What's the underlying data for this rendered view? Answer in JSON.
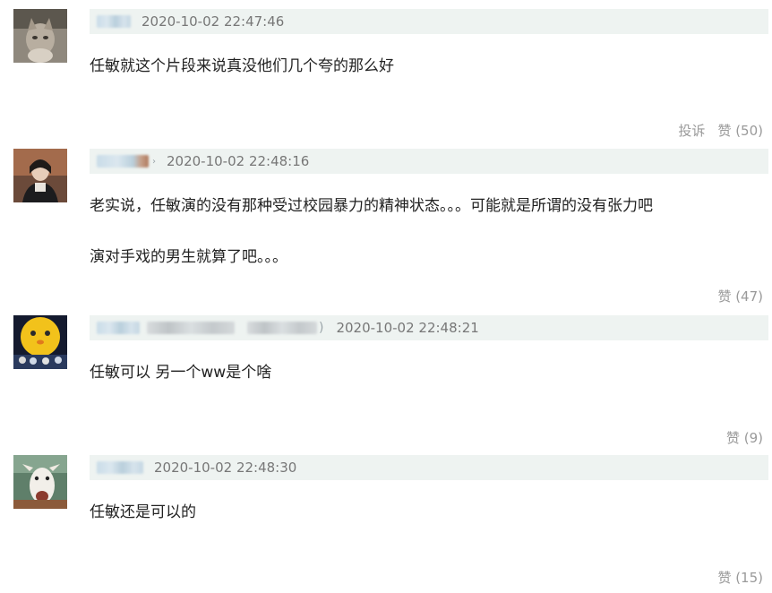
{
  "comments": [
    {
      "avatar_icon": "cat-avatar-icon",
      "timestamp": "2020-10-02 22:47:46",
      "lines": [
        "任敏就这个片段来说真没他们几个夸的那么好"
      ],
      "report_label": "投诉",
      "like_label": "赞 (50)"
    },
    {
      "avatar_icon": "person-avatar-icon",
      "timestamp": "2020-10-02 22:48:16",
      "lines": [
        "老实说，任敏演的没有那种受过校园暴力的精神状态。。。可能就是所谓的没有张力吧",
        "演对手戏的男生就算了吧。。。"
      ],
      "like_label": "赞 (47)"
    },
    {
      "avatar_icon": "moon-face-avatar-icon",
      "timestamp": "2020-10-02 22:48:21",
      "paren": ")",
      "lines": [
        "任敏可以 另一个ww是个啥"
      ],
      "like_label": "赞 (9)"
    },
    {
      "avatar_icon": "goat-avatar-icon",
      "timestamp": "2020-10-02 22:48:30",
      "lines": [
        "任敏还是可以的"
      ],
      "like_label": "赞 (15)"
    }
  ]
}
